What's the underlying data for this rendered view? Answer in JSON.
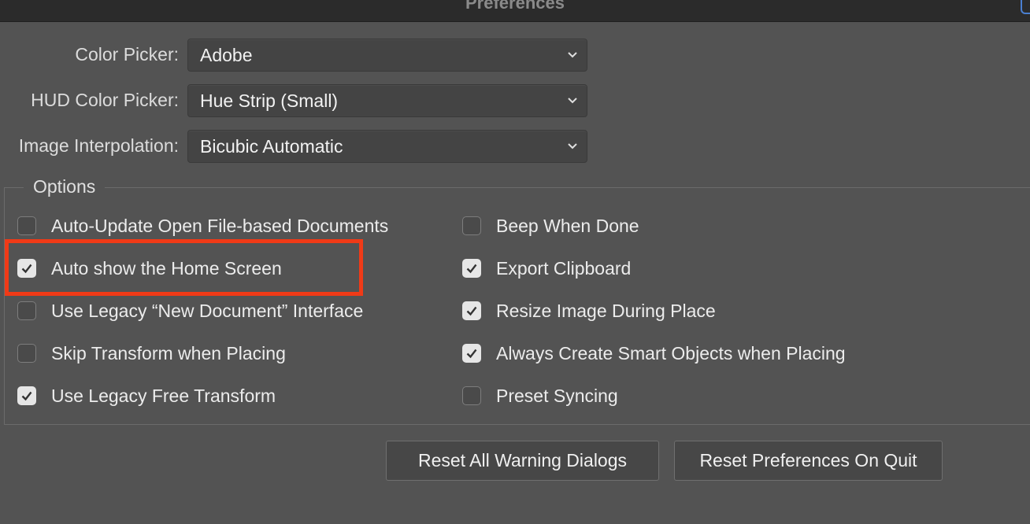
{
  "window": {
    "title": "Preferences"
  },
  "color_picker": {
    "label": "Color Picker:",
    "value": "Adobe"
  },
  "hud_color_picker": {
    "label": "HUD Color Picker:",
    "value": "Hue Strip (Small)"
  },
  "image_interpolation": {
    "label": "Image Interpolation:",
    "value": "Bicubic Automatic"
  },
  "options": {
    "legend": "Options",
    "left": [
      {
        "label": "Auto-Update Open File-based Documents",
        "checked": false
      },
      {
        "label": "Auto show the Home Screen",
        "checked": true
      },
      {
        "label": "Use Legacy “New Document” Interface",
        "checked": false
      },
      {
        "label": "Skip Transform when Placing",
        "checked": false
      },
      {
        "label": "Use Legacy Free Transform",
        "checked": true
      }
    ],
    "right": [
      {
        "label": "Beep When Done",
        "checked": false
      },
      {
        "label": "Export Clipboard",
        "checked": true
      },
      {
        "label": "Resize Image During Place",
        "checked": true
      },
      {
        "label": "Always Create Smart Objects when Placing",
        "checked": true
      },
      {
        "label": "Preset Syncing",
        "checked": false
      }
    ]
  },
  "buttons": {
    "reset_warnings": "Reset All Warning Dialogs",
    "reset_prefs": "Reset Preferences On Quit"
  },
  "colors": {
    "highlight": "#f03a17",
    "background": "#535353"
  }
}
